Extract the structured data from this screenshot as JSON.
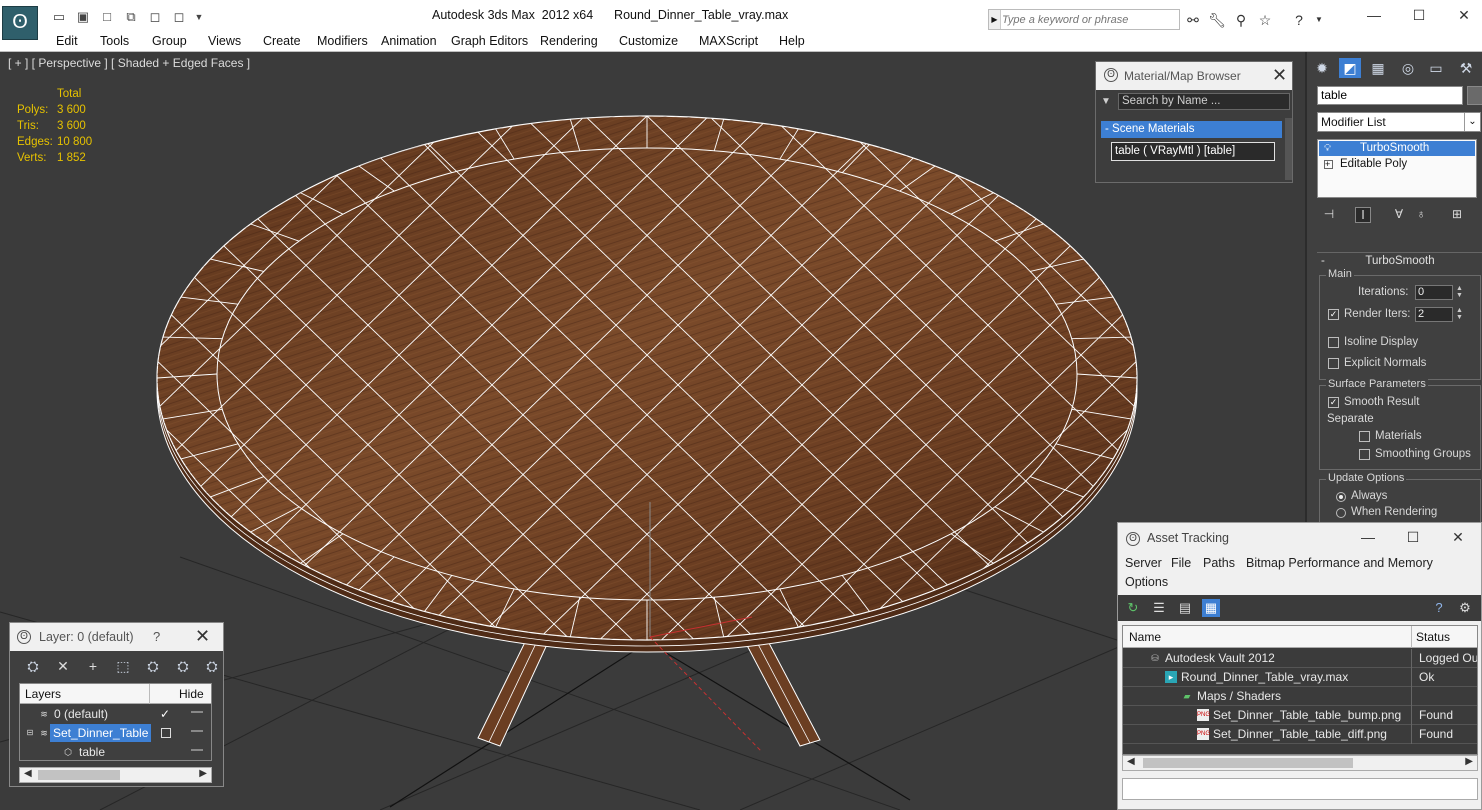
{
  "titlebar": {
    "app_logo": "3ds-max-logo-icon",
    "title": "Autodesk 3ds Max  2012 x64      Round_Dinner_Table_vray.max",
    "quick_access": [
      "open-icon",
      "save-icon",
      "new-icon",
      "project-icon",
      "window-crossing-icon",
      "selection-region-icon",
      "dropdown-icon"
    ],
    "search_placeholder": "Type a keyword or phrase",
    "help_icons": [
      "binoculars-icon",
      "wrench-icon",
      "signin-icon",
      "star-icon",
      "help-icon"
    ]
  },
  "menu": [
    "Edit",
    "Tools",
    "Group",
    "Views",
    "Create",
    "Modifiers",
    "Animation",
    "Graph Editors",
    "Rendering",
    "Customize",
    "MAXScript",
    "Help"
  ],
  "viewport": {
    "label": "[ + ] [ Perspective ] [ Shaded + Edged Faces ]",
    "stats_header": "Total",
    "stats": [
      {
        "k": "Polys:",
        "v": "3 600"
      },
      {
        "k": "Tris:",
        "v": "3 600"
      },
      {
        "k": "Edges:",
        "v": "10 800"
      },
      {
        "k": "Verts:",
        "v": "1 852"
      }
    ],
    "colors": {
      "background": "#3b3b3b",
      "wood": "#6b3e22",
      "wire": "#ffffff",
      "stats": "#e6c200"
    }
  },
  "command_panel": {
    "tabs": [
      "create-icon",
      "modify-icon",
      "hierarchy-icon",
      "motion-icon",
      "display-icon",
      "utilities-icon"
    ],
    "object_name": "table",
    "modifier_list": "Modifier List",
    "stack": [
      {
        "label": "TurboSmooth",
        "selected": true
      },
      {
        "label": "Editable Poly",
        "selected": false
      }
    ],
    "rollout_title": "TurboSmooth",
    "main_group": "Main",
    "iterations_label": "Iterations:",
    "iterations_value": "0",
    "render_iters_label": "Render Iters:",
    "render_iters_value": "2",
    "isoline_label": "Isoline Display",
    "explicit_normals_label": "Explicit Normals",
    "surface_group": "Surface Parameters",
    "smooth_result_label": "Smooth Result",
    "separate_label": "Separate",
    "materials_label": "Materials",
    "smoothing_groups_label": "Smoothing Groups",
    "update_group": "Update Options",
    "always_label": "Always",
    "when_rendering_label": "When Rendering"
  },
  "material_browser": {
    "title": "Material/Map Browser",
    "search_placeholder": "Search by Name ...",
    "group": "- Scene Materials",
    "item": "table  ( VRayMtl )  [table]"
  },
  "asset_tracking": {
    "title": "Asset Tracking",
    "menu": [
      "Server",
      "File",
      "Paths",
      "Bitmap Performance and Memory",
      "Options"
    ],
    "col_name": "Name",
    "col_status": "Status",
    "rows": [
      {
        "name": "Autodesk Vault 2012",
        "status": "Logged Ou",
        "icon": "vault-icon",
        "indent": 1
      },
      {
        "name": "Round_Dinner_Table_vray.max",
        "status": "Ok",
        "icon": "max-file-icon",
        "indent": 2
      },
      {
        "name": "Maps / Shaders",
        "status": "",
        "icon": "maps-icon",
        "indent": 3
      },
      {
        "name": "Set_Dinner_Table_table_bump.png",
        "status": "Found",
        "icon": "png-icon",
        "indent": 4
      },
      {
        "name": "Set_Dinner_Table_table_diff.png",
        "status": "Found",
        "icon": "png-icon",
        "indent": 4
      }
    ]
  },
  "layer_manager": {
    "title": "Layer: 0 (default)",
    "help": "?",
    "col_layers": "Layers",
    "col_hide": "Hide",
    "rows": [
      {
        "name": "0 (default)",
        "selected": false,
        "checked": true
      },
      {
        "name": "Set_Dinner_Table",
        "selected": true,
        "checked": false
      },
      {
        "name": "table",
        "selected": false,
        "checked": false
      }
    ]
  }
}
